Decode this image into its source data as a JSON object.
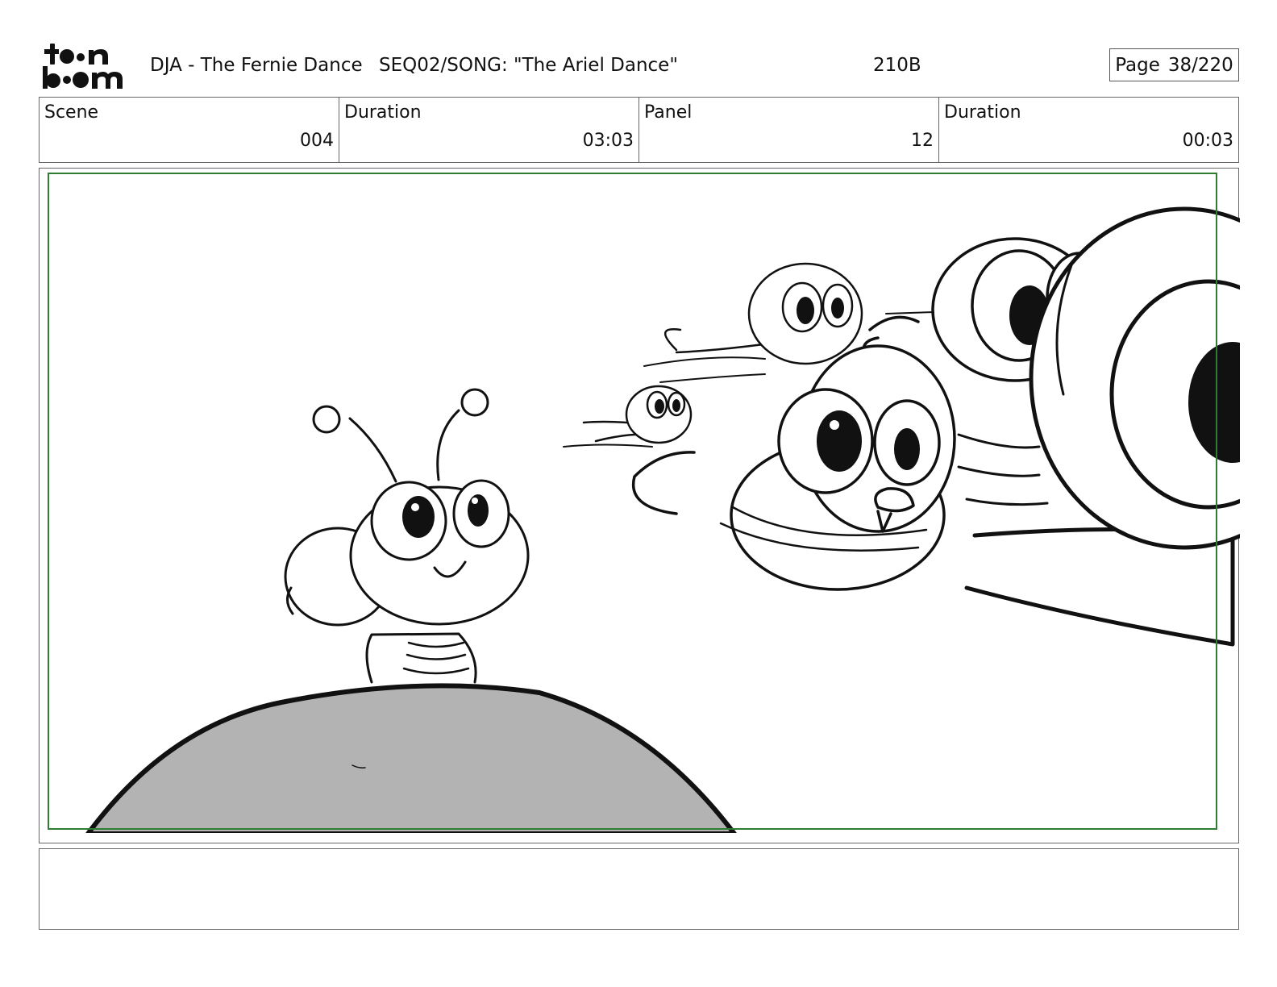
{
  "header": {
    "logo_top": "to•n",
    "logo_bottom": "b••m",
    "project": "DJA - The Fernie Dance",
    "sequence": "SEQ02/SONG: \"The Ariel Dance\"",
    "code": "210B",
    "page_label": "Page",
    "page_number": "38/220"
  },
  "info": {
    "scene_label": "Scene",
    "scene_value": "004",
    "scene_duration_label": "Duration",
    "scene_duration_value": "03:03",
    "panel_label": "Panel",
    "panel_value": "12",
    "panel_duration_label": "Duration",
    "panel_duration_value": "00:03"
  },
  "colors": {
    "safe_frame": "#2e7d32",
    "hill_fill": "#b3b3b3",
    "line": "#111111"
  },
  "notes": ""
}
